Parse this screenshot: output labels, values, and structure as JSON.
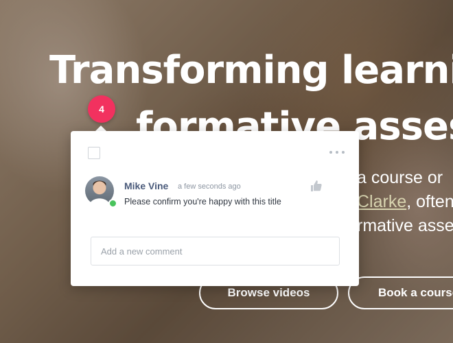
{
  "hero": {
    "title_line1": "Transforming learnin",
    "title_line2": "formative assess",
    "text_line1": "a course or",
    "text_line2_link": "Clarke",
    "text_line2_rest": ", often",
    "text_line3": "rmative asse",
    "buttons": {
      "browse": "Browse videos",
      "book": "Book a course"
    }
  },
  "comments_badge": {
    "count": "4",
    "color": "#f2315f"
  },
  "comment_popup": {
    "checkbox_checked": false,
    "more_icon": "more-horizontal-icon",
    "comment": {
      "author": "Mike Vine",
      "timestamp": "a few seconds ago",
      "text": "Please confirm you're happy with this title",
      "status": "online",
      "status_color": "#49c35c",
      "like_icon": "thumbs-up-icon"
    },
    "new_comment": {
      "placeholder": "Add a new comment",
      "value": ""
    }
  }
}
